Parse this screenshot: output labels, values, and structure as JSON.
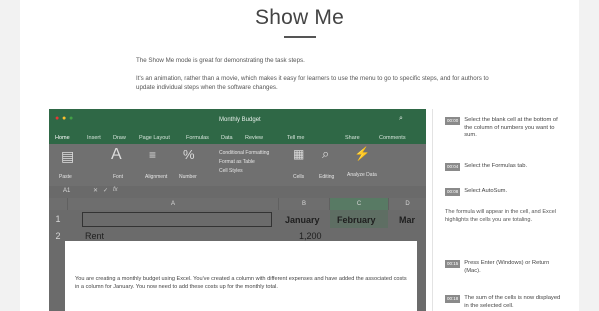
{
  "page": {
    "title": "Show Me",
    "intro_1": "The Show Me mode is great for demonstrating the task steps.",
    "intro_2": "It's an animation, rather than a movie, which makes it easy for learners to use the menu to go to specific steps, and for authors to update individual steps when the software changes."
  },
  "excel": {
    "doc_title": "Monthly Budget",
    "tabs": [
      "Home",
      "Insert",
      "Draw",
      "Page Layout",
      "Formulas",
      "Data",
      "Review",
      "Tell me",
      "Share",
      "Comments"
    ],
    "ribbon": [
      "Paste",
      "Font",
      "Alignment",
      "Number",
      "Conditional Formatting",
      "Format as Table",
      "Cell Styles",
      "Cells",
      "Editing",
      "Analyze Data"
    ],
    "name_box": "A1",
    "columns": [
      "A",
      "B",
      "C",
      "D"
    ],
    "rows": [
      {
        "num": "1",
        "a": "",
        "b": "January",
        "c": "February",
        "d": "Mar"
      },
      {
        "num": "2",
        "a": "Rent",
        "b": "1,200",
        "c": "",
        "d": ""
      }
    ],
    "popup_text": "You are creating a monthly budget using Excel. You've created a column with different expenses and have added the associated costs in a column for January. You now need to add these costs up for the monthly total."
  },
  "steps": [
    {
      "time": "00:00",
      "text": "Select the blank cell at the bottom of the column of numbers you want to sum."
    },
    {
      "time": "00:04",
      "text": "Select the Formulas tab."
    },
    {
      "time": "00:08",
      "text": "Select AutoSum."
    },
    {
      "note": "The formula will appear in the cell, and Excel highlights the cells you are totaling."
    },
    {
      "time": "00:15",
      "text": "Press Enter (Windows) or Return (Mac)."
    },
    {
      "time": "00:18",
      "text": "The sum of the cells is now displayed in the selected cell."
    }
  ]
}
